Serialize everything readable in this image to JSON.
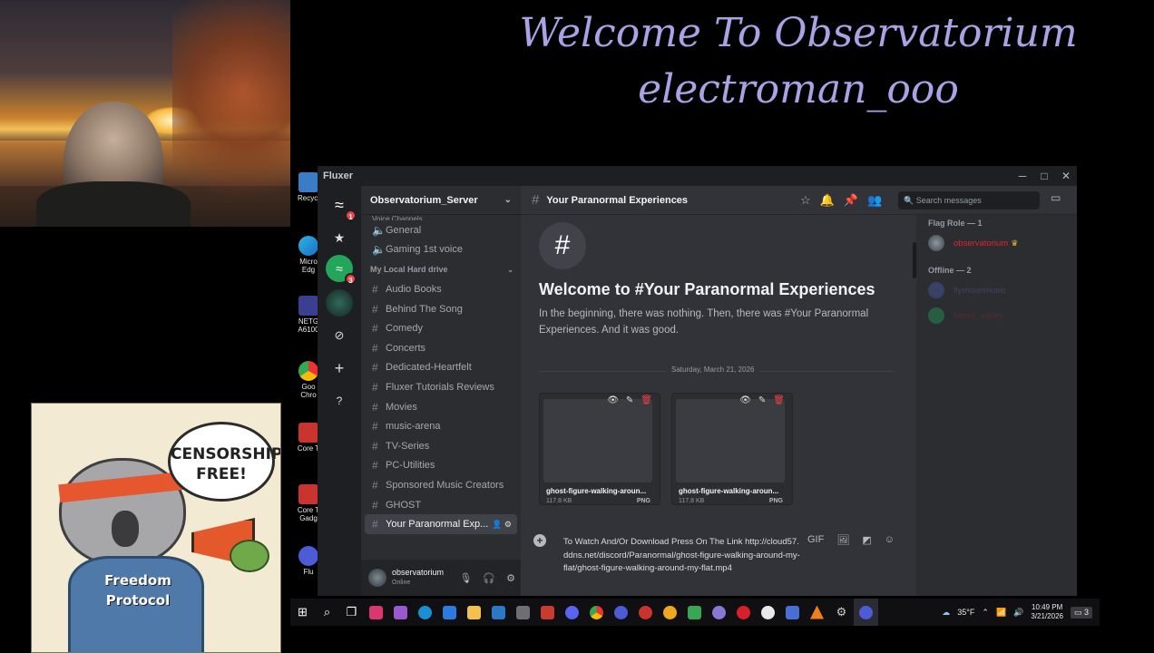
{
  "overlay": {
    "line1": "Welcome To Observatorium",
    "line2": "electroman_ooo"
  },
  "poster": {
    "bubble": "CENSORSHIP FREE!",
    "hoodie": "Freedom Protocol"
  },
  "desktop_icons": [
    "Recycl",
    "Micro Edg",
    "NETG A6100",
    "Goo Chro",
    "Core T",
    "Core T Gadg",
    "Flu"
  ],
  "window": {
    "title": "Fluxer",
    "controls": {
      "minimize": "─",
      "maximize": "□",
      "close": "✕"
    }
  },
  "guild_bar": {
    "home_badge": "1",
    "fluxer_badge": "3"
  },
  "server": {
    "name": "Observatorium_Server",
    "truncated_category": "Voice Channels",
    "voice_channels": [
      "General",
      "Gaming 1st voice"
    ],
    "category": "My Local Hard drive",
    "text_channels": [
      "Audio Books",
      "Behind The Song",
      "Comedy",
      "Concerts",
      "Dedicated-Heartfelt",
      "Fluxer Tutorials Reviews",
      "Movies",
      "music-arena",
      "TV-Series",
      "PC-Utilities",
      "Sponsored Music Creators",
      "GHOST"
    ],
    "active_channel": "Your Paranormal Exp..."
  },
  "user_panel": {
    "name": "observatorium",
    "status": "Online"
  },
  "chat": {
    "channel_name": "Your Paranormal Experiences",
    "search_placeholder": "Search messages",
    "welcome_title": "Welcome to #Your Paranormal Experiences",
    "welcome_desc": "In the beginning, there was nothing. Then, there was #Your Paranormal Experiences. And it was good.",
    "date_divider": "Saturday, March 21, 2026",
    "attachments": [
      {
        "name": "ghost-figure-walking-aroun...",
        "size": "117.8 KB",
        "type": "PNG"
      },
      {
        "name": "ghost-figure-walking-aroun...",
        "size": "117.8 KB",
        "type": "PNG"
      }
    ],
    "composer_text": "To Watch And/Or Download Press On The Link http://cloud57.ddns.net/discord/Paranormal/ghost-figure-walking-around-my-flat/ghost-figure-walking-around-my-flat.mp4"
  },
  "members": {
    "role_header": "Flag Role — 1",
    "role_members": [
      {
        "name": "observatorium",
        "color": "#e0242e"
      }
    ],
    "offline_header": "Offline — 2",
    "offline_members": [
      {
        "name": "flymoonmusic",
        "color": "#5865a8"
      },
      {
        "name": "Music_valley",
        "color": "#8a2a30"
      }
    ]
  },
  "taskbar": {
    "weather": "35°F",
    "time": "10:49 PM",
    "date": "3/21/2026",
    "notification_count": "3"
  },
  "colors": {
    "accent": "#5865f2",
    "danger": "#f23f43",
    "overlay_text": "#a9a3e6"
  }
}
